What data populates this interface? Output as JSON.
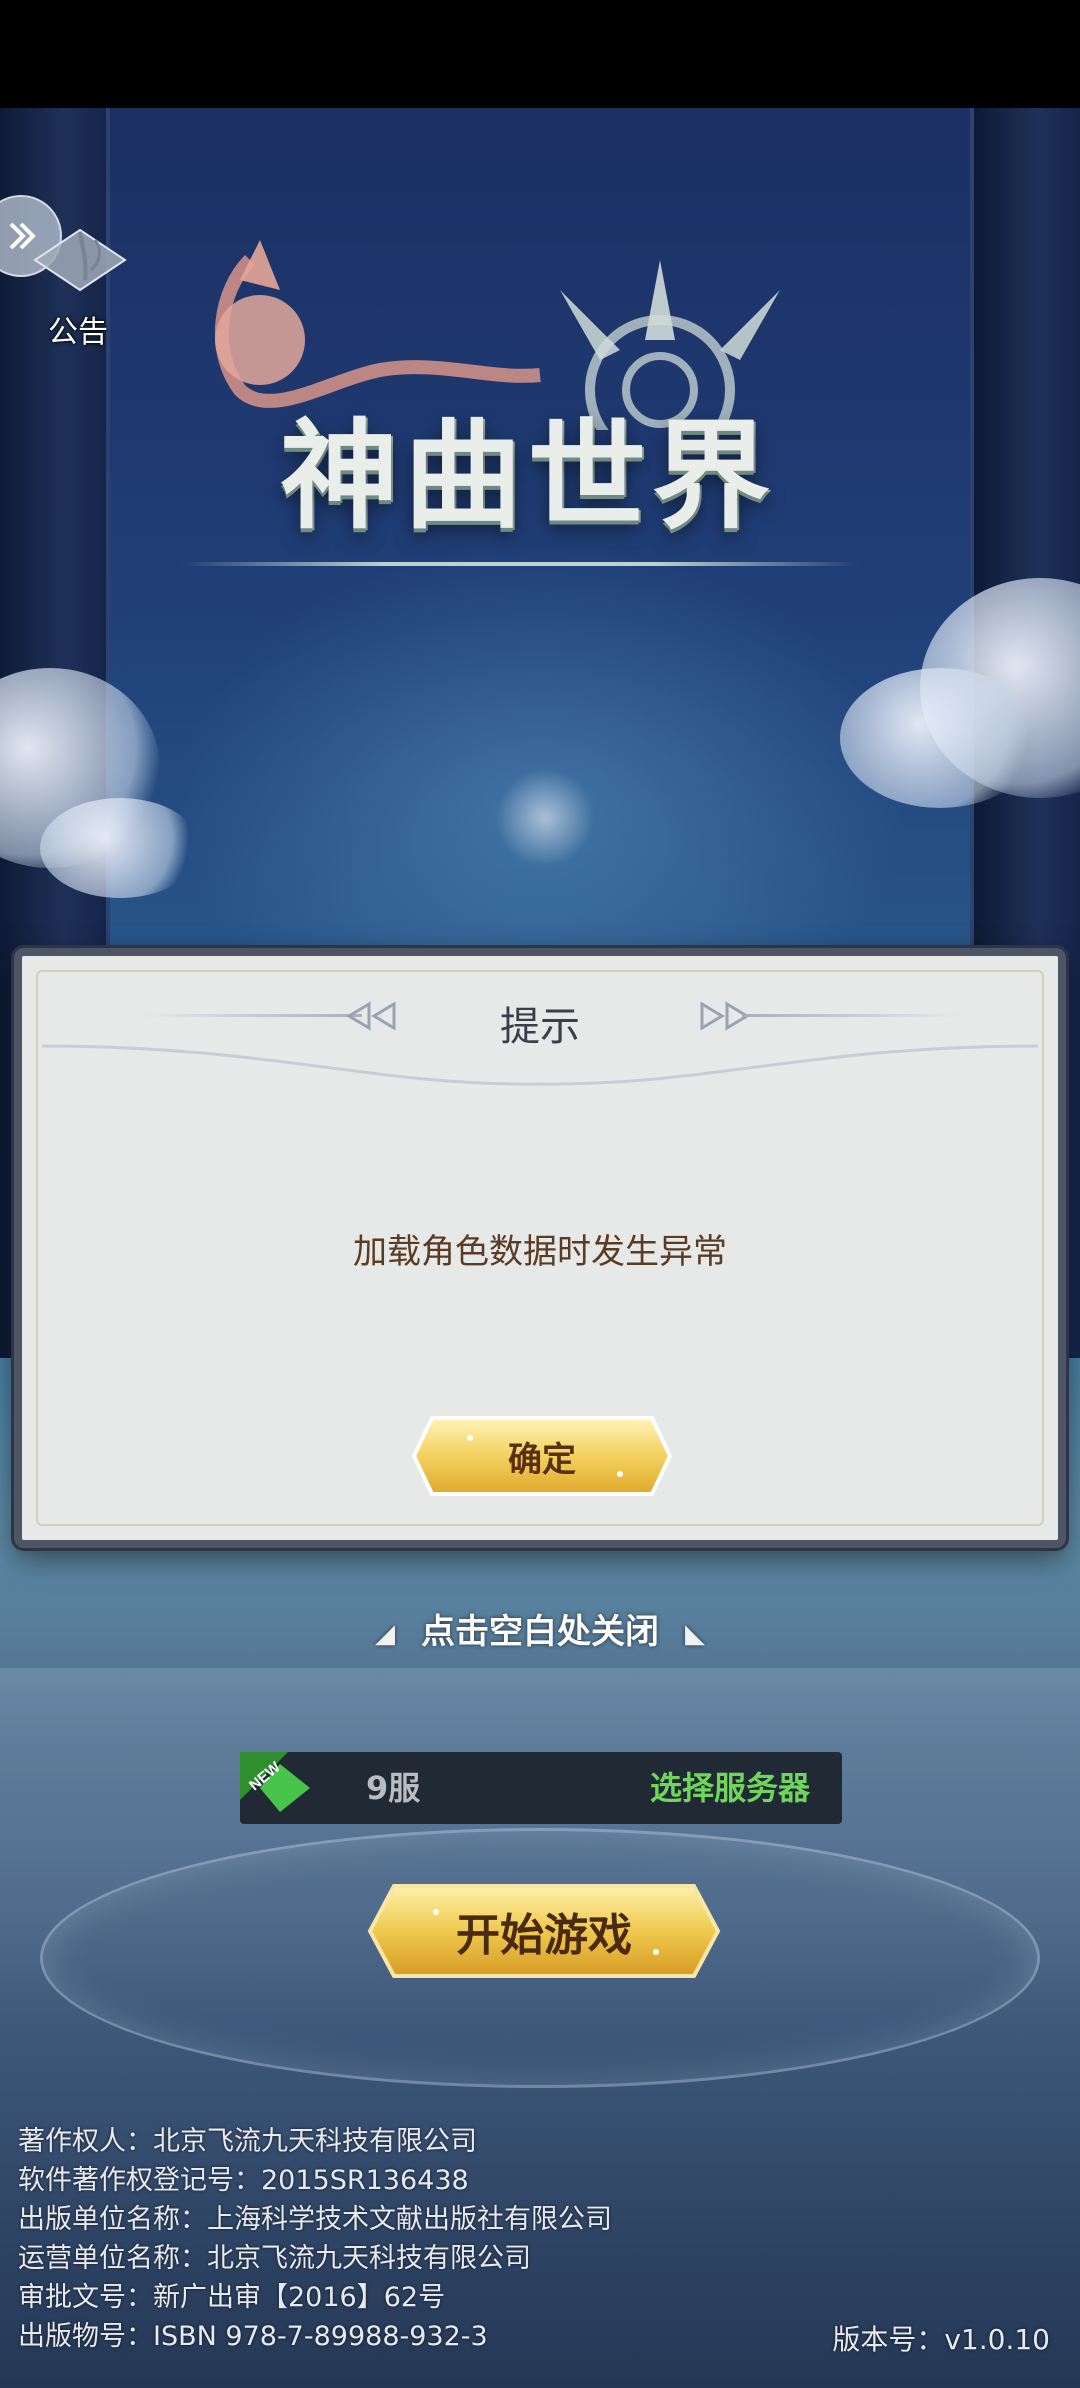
{
  "notice": {
    "label": "公告",
    "icon": "notice-book-icon"
  },
  "logo": {
    "title": "神曲世界"
  },
  "dialog": {
    "title": "提示",
    "message": "加载角色数据时发生异常",
    "confirm_label": "确定",
    "close_hint": "点击空白处关闭"
  },
  "server": {
    "badge": "NEW",
    "name": "9服",
    "select_label": "选择服务器",
    "select_color": "#6fd65b"
  },
  "start_button": {
    "label": "开始游戏"
  },
  "legal": {
    "lines": [
      "著作权人：北京飞流九天科技有限公司",
      "软件著作权登记号：2015SR136438",
      "出版单位名称：上海科学技术文献出版社有限公司",
      "运营单位名称：北京飞流九天科技有限公司",
      "审批文号：新广出审【2016】62号",
      "出版物号：ISBN 978-7-89988-932-3"
    ],
    "version": "版本号：v1.0.10"
  },
  "colors": {
    "gold": "#f3d15e",
    "dialog_bg": "#e7e8e8",
    "dialog_border": "#4d5566"
  }
}
